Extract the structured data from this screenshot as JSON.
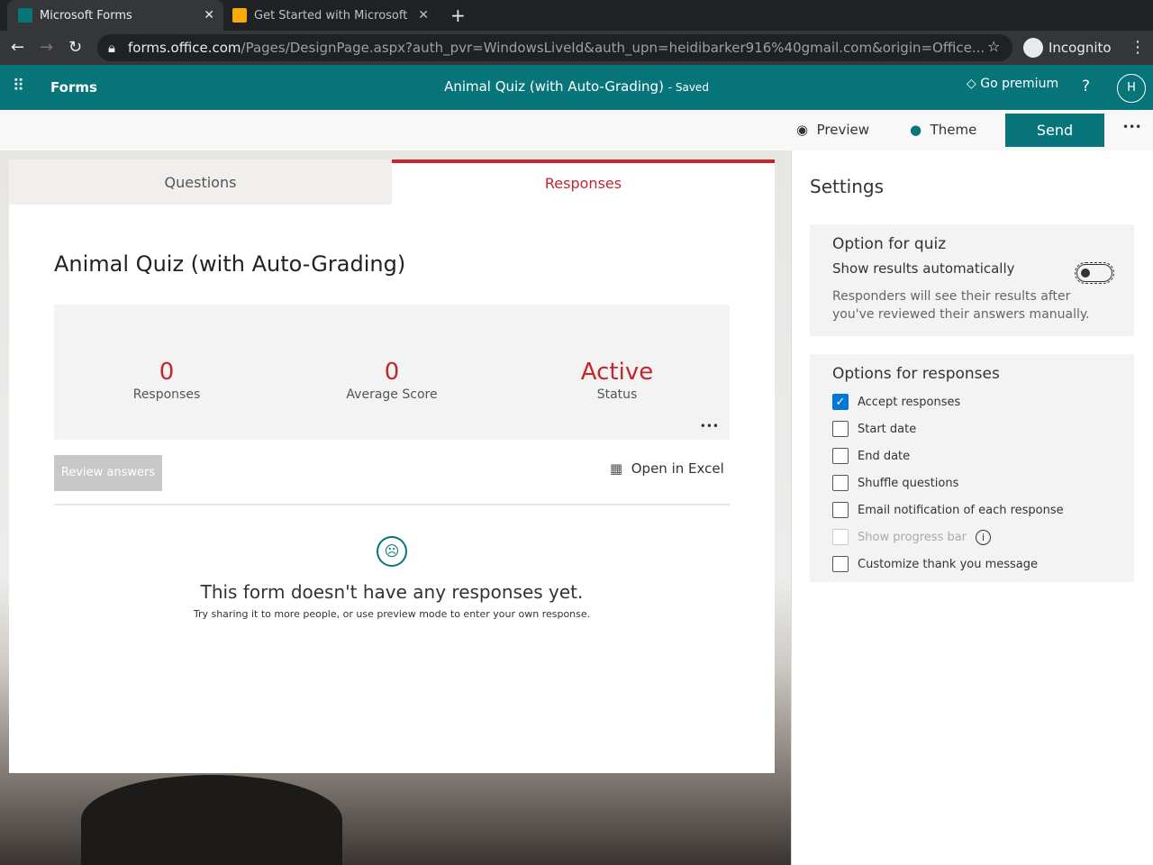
{
  "browser": {
    "tabs": [
      {
        "title": "Microsoft Forms"
      },
      {
        "title": "Get Started with Microsoft"
      }
    ],
    "url_host": "forms.office.com",
    "url_rest": "/Pages/DesignPage.aspx?auth_pvr=WindowsLiveId&auth_upn=heidibarker916%40gmail.com&origin=Office...",
    "incognito": "Incognito"
  },
  "header": {
    "app": "Forms",
    "title": "Animal Quiz (with Auto-Grading)",
    "saved": "- Saved",
    "premium": "Go premium",
    "help": "?",
    "avatar": "H"
  },
  "cmd": {
    "preview": "Preview",
    "theme": "Theme",
    "send": "Send",
    "more": "•••"
  },
  "tabs": {
    "questions": "Questions",
    "responses": "Responses"
  },
  "main": {
    "title": "Animal Quiz (with Auto-Grading)",
    "stats": [
      {
        "value": "0",
        "label": "Responses"
      },
      {
        "value": "0",
        "label": "Average Score"
      },
      {
        "value": "Active",
        "label": "Status"
      }
    ],
    "review": "Review answers",
    "excel": "Open in Excel",
    "empty_title": "This form doesn't have any responses yet.",
    "empty_sub": "Try sharing it to more people, or use preview mode to enter your own response."
  },
  "settings": {
    "title": "Settings",
    "quiz_heading": "Option for quiz",
    "show_results": "Show results automatically",
    "quiz_note": "Responders will see their results after you've reviewed their answers manually.",
    "resp_heading": "Options for responses",
    "options": [
      {
        "label": "Accept responses",
        "checked": true
      },
      {
        "label": "Start date"
      },
      {
        "label": "End date"
      },
      {
        "label": "Shuffle questions"
      },
      {
        "label": "Email notification of each response"
      },
      {
        "label": "Show progress bar",
        "disabled": true
      },
      {
        "label": "Customize thank you message"
      }
    ]
  },
  "colors": {
    "brand": "#077579",
    "accent": "#c4262e"
  }
}
